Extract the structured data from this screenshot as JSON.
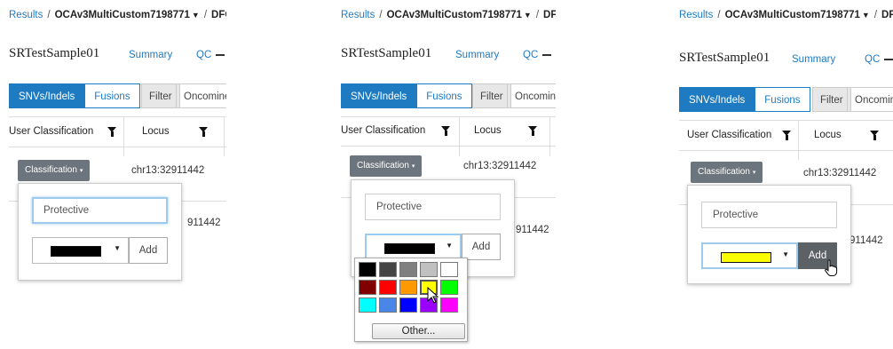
{
  "breadcrumb": {
    "results": "Results",
    "separator": "/",
    "project": "OCAv3MultiCustom7198771",
    "caret": "▼",
    "trailing": "DFO"
  },
  "sample_name": "SRTestSample01",
  "nav": {
    "summary": "Summary",
    "qc": "QC"
  },
  "tabs": {
    "snvs": "SNVs/Indels",
    "fusions": "Fusions"
  },
  "toolbar": {
    "filter": "Filter",
    "oncomine": "Oncomine"
  },
  "table": {
    "col_user_classification": "User Classification",
    "col_locus": "Locus",
    "row1_locus": "chr13:32911442",
    "row2_locus_partial": "911442",
    "row2_locus_partial_p3": "911442"
  },
  "classification_button": {
    "label": "Classification",
    "caret": "▾"
  },
  "popup": {
    "input_value": "Protective",
    "add_label": "Add",
    "select_caret": "▼"
  },
  "colors": {
    "panel1_selected": "#000000",
    "panel2_selected": "#000000",
    "panel3_selected": "#ffff00",
    "accent": "#1f7bc1"
  },
  "palette": {
    "rows": [
      [
        "#000000",
        "#444444",
        "#808080",
        "#c0c0c0",
        "#ffffff"
      ],
      [
        "#800000",
        "#ff0000",
        "#ff9900",
        "#ffff00",
        "#00ff00"
      ],
      [
        "#00ffff",
        "#4a86e8",
        "#0000ff",
        "#9900ff",
        "#ff00ff"
      ]
    ],
    "highlighted": "#ffff00",
    "other_label": "Other..."
  }
}
